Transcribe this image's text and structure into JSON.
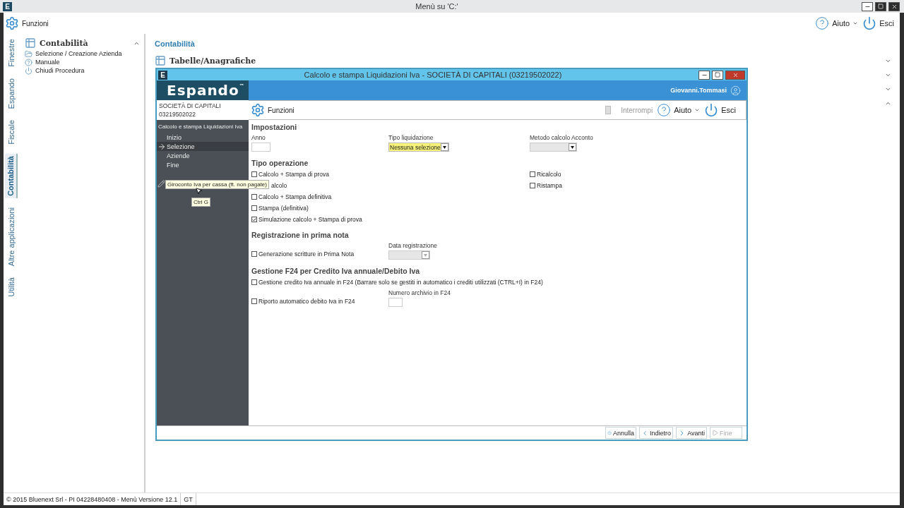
{
  "window": {
    "badge": "E",
    "title": "Menù su 'C:'"
  },
  "toolbar": {
    "functions": "Funzioni",
    "help": "Aiuto",
    "exit": "Esci"
  },
  "side_tabs": [
    {
      "label": "Finestre",
      "selected": false
    },
    {
      "label": "Espando",
      "selected": false
    },
    {
      "label": "Fiscale",
      "selected": false
    },
    {
      "label": "Contabilità",
      "selected": true
    },
    {
      "label": "Altre applicazioni",
      "selected": false
    },
    {
      "label": "Utilità",
      "selected": false
    }
  ],
  "side_panel": {
    "title": "Contabilità",
    "expanded": true,
    "items": [
      {
        "kind": "company",
        "label": "Selezione / Creazione Azienda"
      },
      {
        "kind": "help",
        "label": "Manuale"
      },
      {
        "kind": "close",
        "label": "Chiudi Procedura"
      }
    ]
  },
  "content": {
    "heading": "Contabilità",
    "sections": [
      {
        "title": "Tabelle/Anagrafiche",
        "expanded": false
      },
      {
        "expanded": false
      },
      {
        "expanded": false
      },
      {
        "expanded": true
      }
    ]
  },
  "status_bar": {
    "text": "© 2015 Bluenext Srl - PI 04228480408 - Menù  Versione 12.1",
    "user": "GT"
  },
  "dialog": {
    "badge": "E",
    "title": "Calcolo e stampa Liquidazioni Iva - SOCIETÀ DI CAPITALI (03219502022)",
    "logo": "Espando",
    "logo_mark": "™",
    "user": "Giovanni.Tommasi",
    "company": [
      "SOCIETÀ DI CAPITALI",
      "03219502022"
    ],
    "procedure": "Calcolo e stampa Liquidazioni Iva",
    "steps": [
      {
        "label": "Inizio",
        "selected": false
      },
      {
        "label": "Selezione",
        "selected": true
      },
      {
        "label": "Aziende",
        "selected": false
      },
      {
        "label": "Fine",
        "selected": false
      }
    ],
    "tooltip": {
      "text": "Giroconto Iva per cassa (ft. non pagate)",
      "shortcut": "Ctrl G"
    },
    "toolbar": {
      "functions": "Funzioni",
      "interrupt": "Interrompi",
      "interrupt_disabled": true,
      "help": "Aiuto",
      "exit": "Esci"
    },
    "settings": {
      "title": "Impostazioni",
      "year_label": "Anno",
      "type_label": "Tipo liquidazione",
      "type_value": "Nessuna selezione",
      "type_highlighted": true,
      "method_label": "Metodo calcolo Acconto",
      "method_disabled": true
    },
    "operation": {
      "title": "Tipo operazione",
      "left": [
        {
          "label": "Calcolo + Stampa di prova",
          "checked": false
        },
        {
          "label": "alcolo",
          "covered": true
        },
        {
          "label": "Calcolo + Stampa definitiva",
          "checked": false
        },
        {
          "label": "Stampa (definitiva)",
          "checked": false
        },
        {
          "label": "Simulazione calcolo + Stampa di prova",
          "checked": true
        }
      ],
      "right": [
        {
          "label": "Ricalcolo",
          "checked": false
        },
        {
          "label": "Ristampa",
          "checked": false
        }
      ]
    },
    "registration": {
      "title": "Registrazione in prima nota",
      "check": {
        "label": "Generazione scritture in Prima Nota",
        "checked": false
      },
      "date_label": "Data registrazione",
      "date_disabled": true
    },
    "f24": {
      "title": "Gestione F24 per Credito Iva annuale/Debito Iva",
      "credit": {
        "label": "Gestione credito Iva annuale in F24 (Barrare solo se gestiti in automatico i crediti utilizzati (CTRL+I) in F24)",
        "checked": false
      },
      "debit": {
        "label": "Riporto automatico debito Iva in F24",
        "checked": false
      },
      "archive_label": "Numero archivio in F24"
    },
    "buttons": [
      {
        "kind": "cancel",
        "label": "Annulla",
        "disabled": false
      },
      {
        "kind": "back",
        "label": "Indietro",
        "disabled": false
      },
      {
        "kind": "next",
        "label": "Avanti",
        "disabled": false
      },
      {
        "kind": "finish",
        "label": "Fine",
        "disabled": true
      }
    ]
  }
}
